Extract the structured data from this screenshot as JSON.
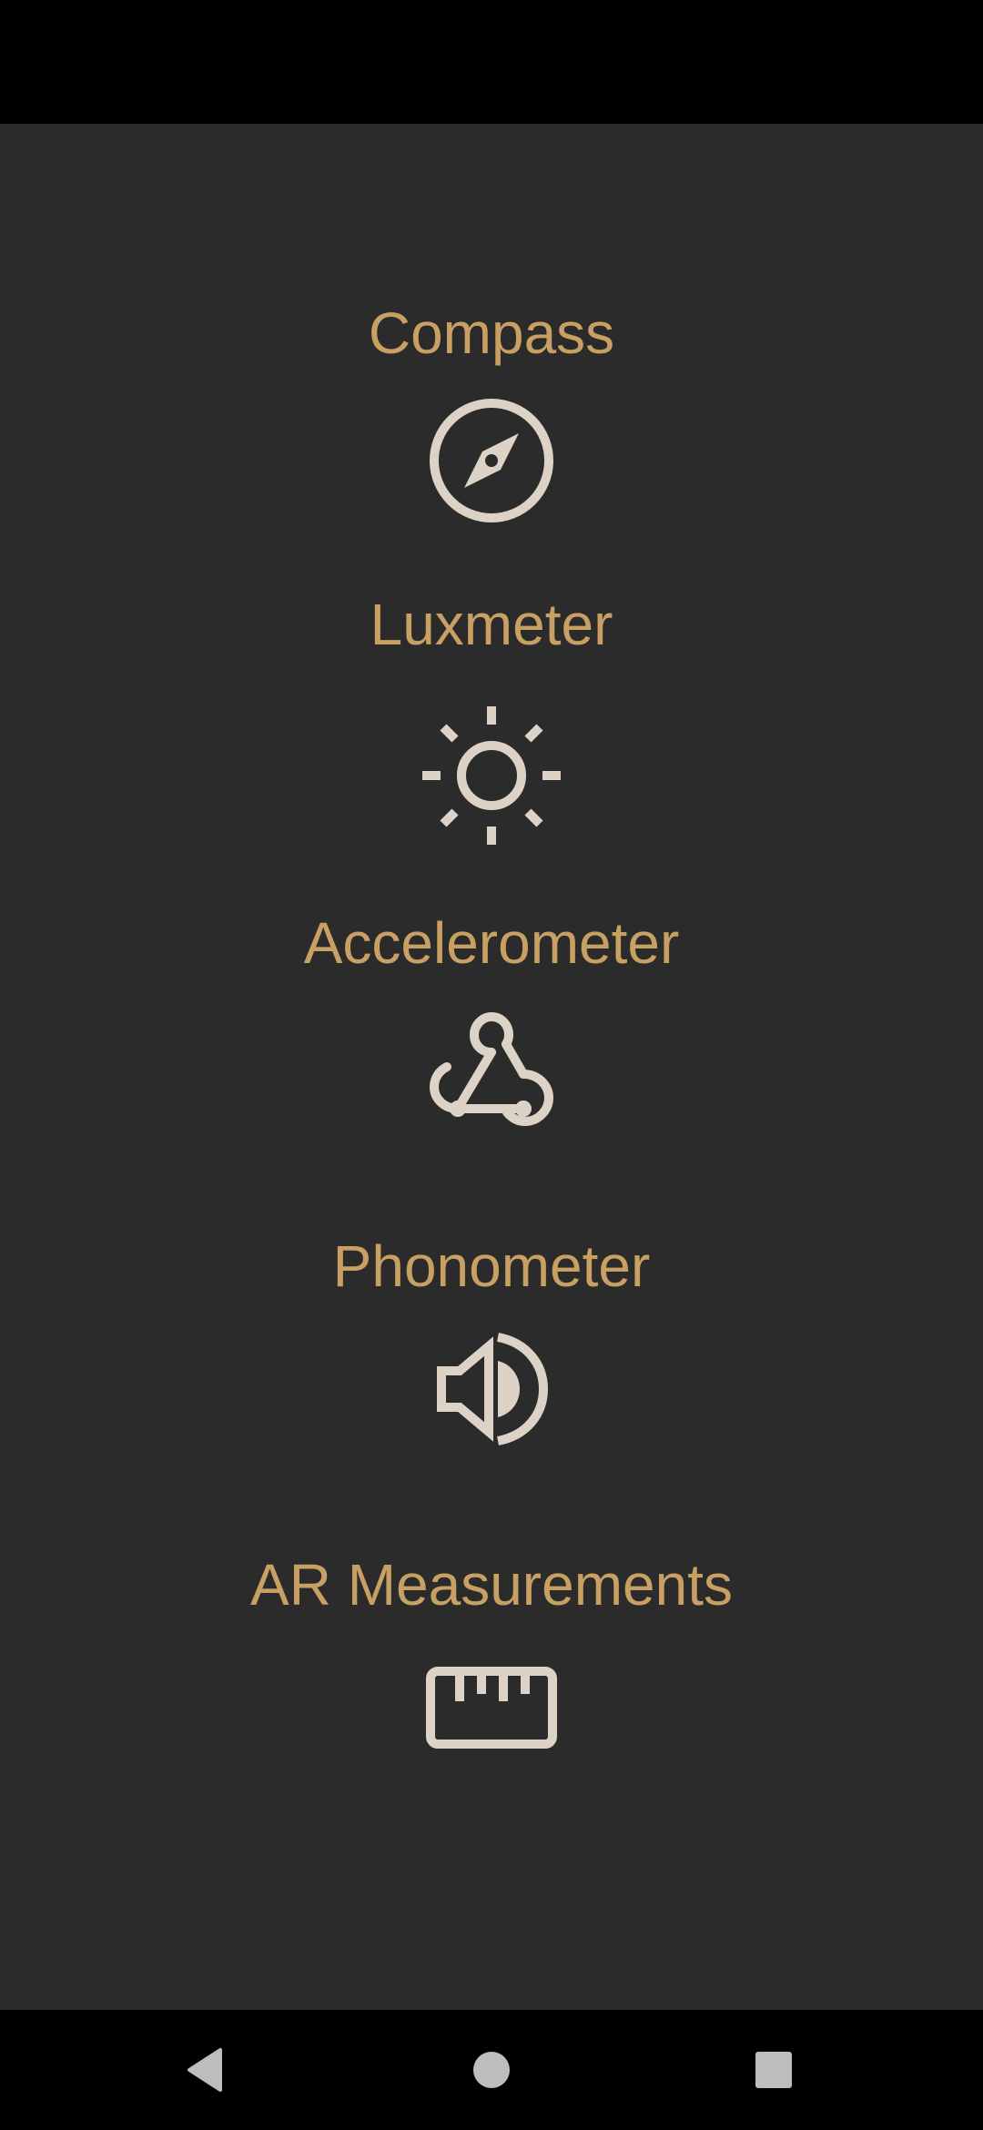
{
  "theme": {
    "label_color": "#c8a063",
    "icon_color": "#dcd3c6",
    "background": "#2b2b2b",
    "system_bar": "#000000",
    "nav_icon_color": "#bdbdbd"
  },
  "tools": [
    {
      "label": "Compass",
      "icon": "compass-icon"
    },
    {
      "label": "Luxmeter",
      "icon": "sun-icon"
    },
    {
      "label": "Accelerometer",
      "icon": "webhook-icon"
    },
    {
      "label": "Phonometer",
      "icon": "speaker-icon"
    },
    {
      "label": "AR Measurements",
      "icon": "ruler-icon"
    }
  ],
  "navigation": {
    "back": "back-icon",
    "home": "home-icon",
    "recents": "recents-icon"
  }
}
